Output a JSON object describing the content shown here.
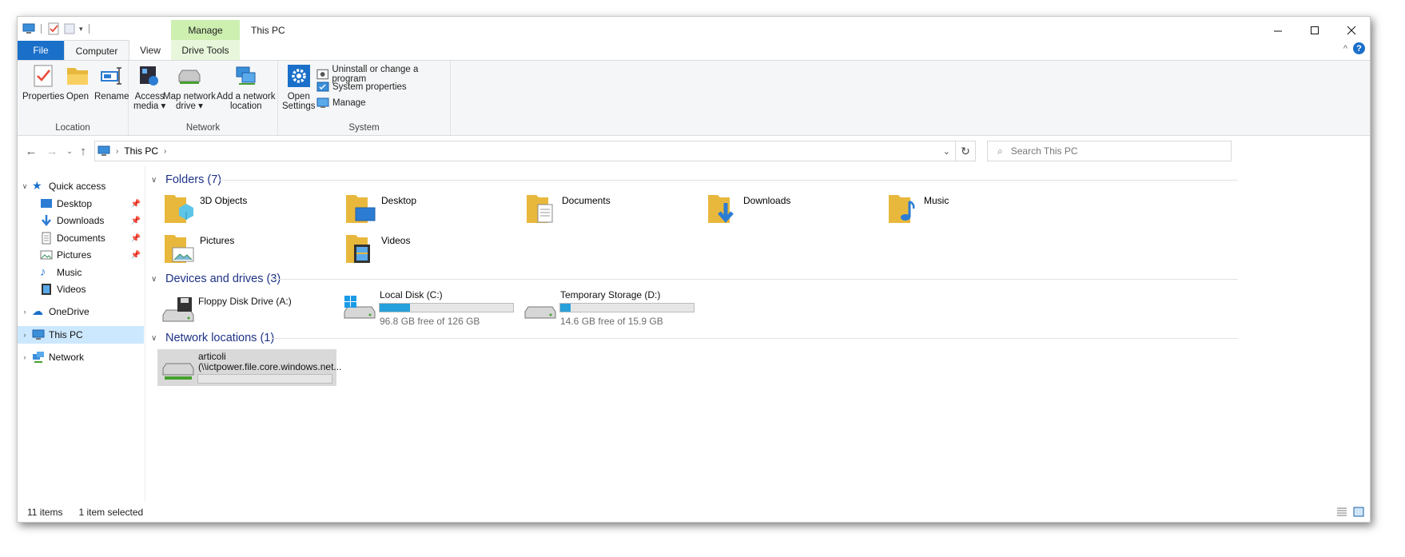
{
  "window": {
    "title": "This PC"
  },
  "ribbon_tabs": {
    "file": "File",
    "computer": "Computer",
    "view": "View",
    "context_header": "Manage",
    "drive_tools": "Drive Tools"
  },
  "ribbon": {
    "location": {
      "label": "Location",
      "properties": "Properties",
      "open": "Open",
      "rename": "Rename"
    },
    "network": {
      "label": "Network",
      "access_media_1": "Access",
      "access_media_2": "media",
      "map_drive_1": "Map network",
      "map_drive_2": "drive",
      "add_location_1": "Add a network",
      "add_location_2": "location"
    },
    "system": {
      "label": "System",
      "open_settings_1": "Open",
      "open_settings_2": "Settings",
      "uninstall": "Uninstall or change a program",
      "system_properties": "System properties",
      "manage": "Manage"
    }
  },
  "navbar": {
    "path": "This PC",
    "search_placeholder": "Search This PC"
  },
  "nav_pane": {
    "quick_access": "Quick access",
    "items": [
      {
        "label": "Desktop",
        "pinned": true
      },
      {
        "label": "Downloads",
        "pinned": true
      },
      {
        "label": "Documents",
        "pinned": true
      },
      {
        "label": "Pictures",
        "pinned": true
      },
      {
        "label": "Music",
        "pinned": false
      },
      {
        "label": "Videos",
        "pinned": false
      }
    ],
    "onedrive": "OneDrive",
    "this_pc": "This PC",
    "network": "Network"
  },
  "sections": {
    "folders": "Folders (7)",
    "devices": "Devices and drives (3)",
    "network": "Network locations (1)"
  },
  "folders": [
    "3D Objects",
    "Desktop",
    "Documents",
    "Downloads",
    "Music",
    "Pictures",
    "Videos"
  ],
  "drives": [
    {
      "name": "Floppy Disk Drive (A:)"
    },
    {
      "name": "Local Disk (C:)",
      "free": "96.8 GB free of 126 GB",
      "used_fraction": 0.23
    },
    {
      "name": "Temporary Storage (D:)",
      "free": "14.6 GB free of 15.9 GB",
      "used_fraction": 0.08
    }
  ],
  "network_location": {
    "name_1": "articoli",
    "name_2": "(\\\\ictpower.file.core.windows.net..."
  },
  "status": {
    "items": "11 items",
    "selected": "1 item selected"
  },
  "colors": {
    "accent": "#1a6fc9",
    "drive_bar": "#26a0da",
    "selected": "#cce8ff",
    "section_heading": "#1e3287"
  }
}
